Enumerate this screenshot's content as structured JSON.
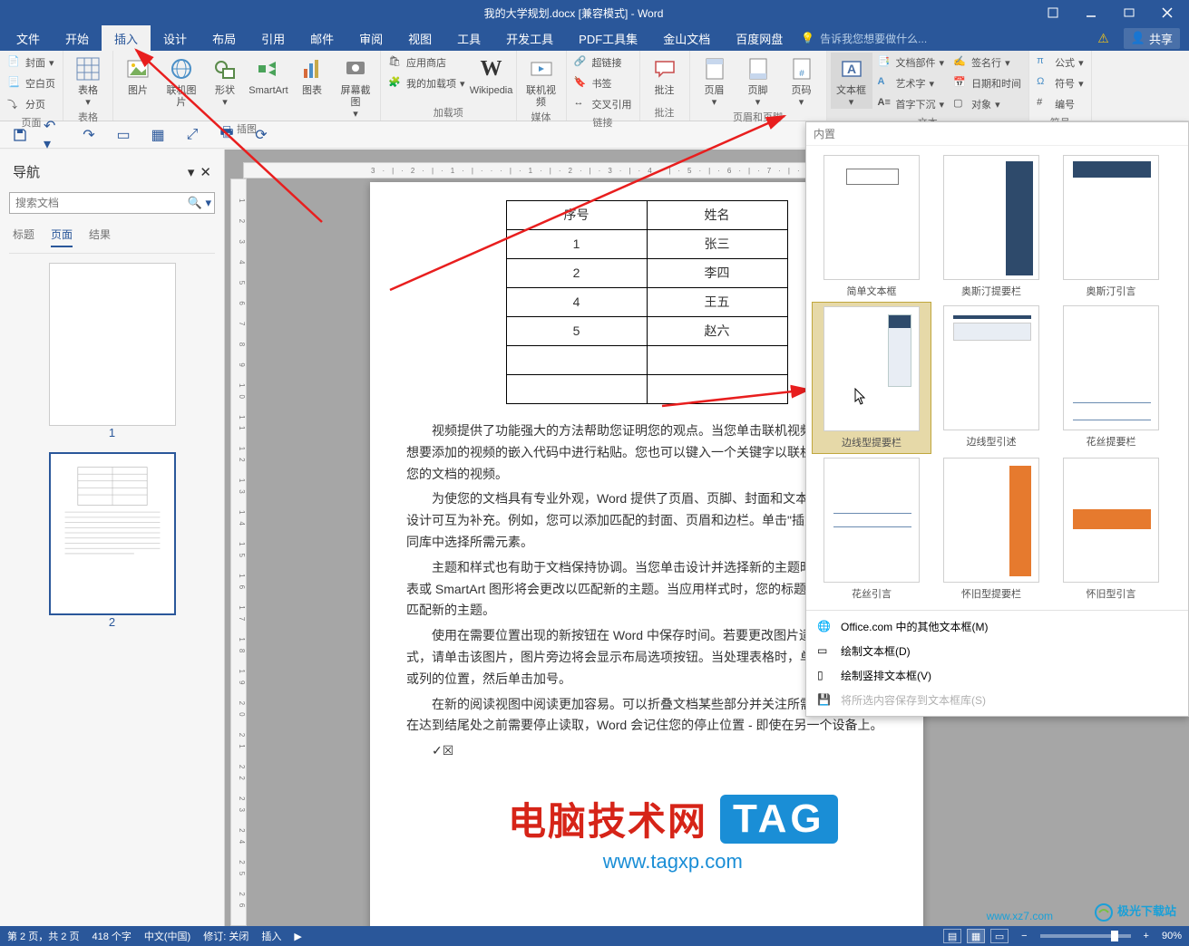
{
  "title": "我的大学规划.docx [兼容模式] - Word",
  "tabs": {
    "file": "文件",
    "home": "开始",
    "insert": "插入",
    "design": "设计",
    "layout": "布局",
    "references": "引用",
    "mailings": "邮件",
    "review": "审阅",
    "view": "视图",
    "tools": "工具",
    "devtools": "开发工具",
    "pdftools": "PDF工具集",
    "wps": "金山文档",
    "baidu": "百度网盘",
    "tellme": "告诉我您想要做什么...",
    "share": "共享"
  },
  "ribbon": {
    "page_group": "页面",
    "cover": "封面",
    "blankpage": "空白页",
    "pagebreak": "分页",
    "table_group": "表格",
    "table": "表格",
    "illustrations": "插图",
    "pictures": "图片",
    "onlinepictures": "联机图片",
    "shapes": "形状",
    "smartart": "SmartArt",
    "chart": "图表",
    "screenshot": "屏幕截图",
    "addins_group": "加载项",
    "store": "应用商店",
    "myaddins": "我的加载项",
    "wikipedia": "Wikipedia",
    "media": "媒体",
    "onlinevideo": "联机视频",
    "links_group": "链接",
    "hyperlink": "超链接",
    "bookmark": "书签",
    "crossref": "交叉引用",
    "comment_group": "批注",
    "comment": "批注",
    "headerfooter_group": "页眉和页脚",
    "header": "页眉",
    "footer": "页脚",
    "pagenum": "页码",
    "text_group": "文本",
    "textbox": "文本框",
    "quickparts": "文档部件",
    "wordart": "艺术字",
    "dropcap": "首字下沉",
    "signature": "签名行",
    "datetime": "日期和时间",
    "object": "对象",
    "symbols_group": "符号",
    "equation": "公式",
    "symbol": "符号",
    "number": "编号"
  },
  "textbox_dd": {
    "header": "内置",
    "items": [
      "简单文本框",
      "奥斯汀提要栏",
      "奥斯汀引言",
      "边线型提要栏",
      "边线型引述",
      "花丝提要栏",
      "花丝引言",
      "怀旧型提要栏",
      "怀旧型引言"
    ],
    "menu_office": "Office.com 中的其他文本框(M)",
    "menu_draw": "绘制文本框(D)",
    "menu_draw_vertical": "绘制竖排文本框(V)",
    "menu_save": "将所选内容保存到文本框库(S)"
  },
  "nav": {
    "title": "导航",
    "search_placeholder": "搜索文档",
    "tabs": {
      "headings": "标题",
      "pages": "页面",
      "results": "结果"
    },
    "page1": "1",
    "page2": "2"
  },
  "doc": {
    "th1": "序号",
    "th2": "姓名",
    "r1c1": "1",
    "r1c2": "张三",
    "r2c1": "2",
    "r2c2": "李四",
    "r3c1": "4",
    "r3c2": "王五",
    "r4c1": "5",
    "r4c2": "赵六",
    "p1": "视频提供了功能强大的方法帮助您证明您的观点。当您单击联机视频时，可以在想要添加的视频的嵌入代码中进行粘贴。您也可以键入一个关键字以联机搜索最适合您的文档的视频。",
    "p2": "为使您的文档具有专业外观，Word 提供了页眉、页脚、封面和文本框设计，这些设计可互为补充。例如，您可以添加匹配的封面、页眉和边栏。单击\"插入\"，然后从不同库中选择所需元素。",
    "p3": "主题和样式也有助于文档保持协调。当您单击设计并选择新的主题时，图片、图表或 SmartArt 图形将会更改以匹配新的主题。当应用样式时，您的标题会进行更改以匹配新的主题。",
    "p4": "使用在需要位置出现的新按钮在 Word 中保存时间。若要更改图片适应文档的方式，请单击该图片，图片旁边将会显示布局选项按钮。当处理表格时，单击要添加行或列的位置，然后单击加号。",
    "p5": "在新的阅读视图中阅读更加容易。可以折叠文档某些部分并关注所需文本。如果在达到结尾处之前需要停止读取，Word 会记住您的停止位置 - 即使在另一个设备上。",
    "checkmarks": "✓☒"
  },
  "status": {
    "page": "第 2 页，共 2 页",
    "words": "418 个字",
    "lang": "中文(中国)",
    "track": "修订: 关闭",
    "insert": "插入",
    "zoom": "90%"
  },
  "watermark": {
    "cn": "电脑技术网",
    "tag": "TAG",
    "url": "www.tagxp.com",
    "site1": "极光下载站",
    "site2": "www.xz7.com"
  }
}
